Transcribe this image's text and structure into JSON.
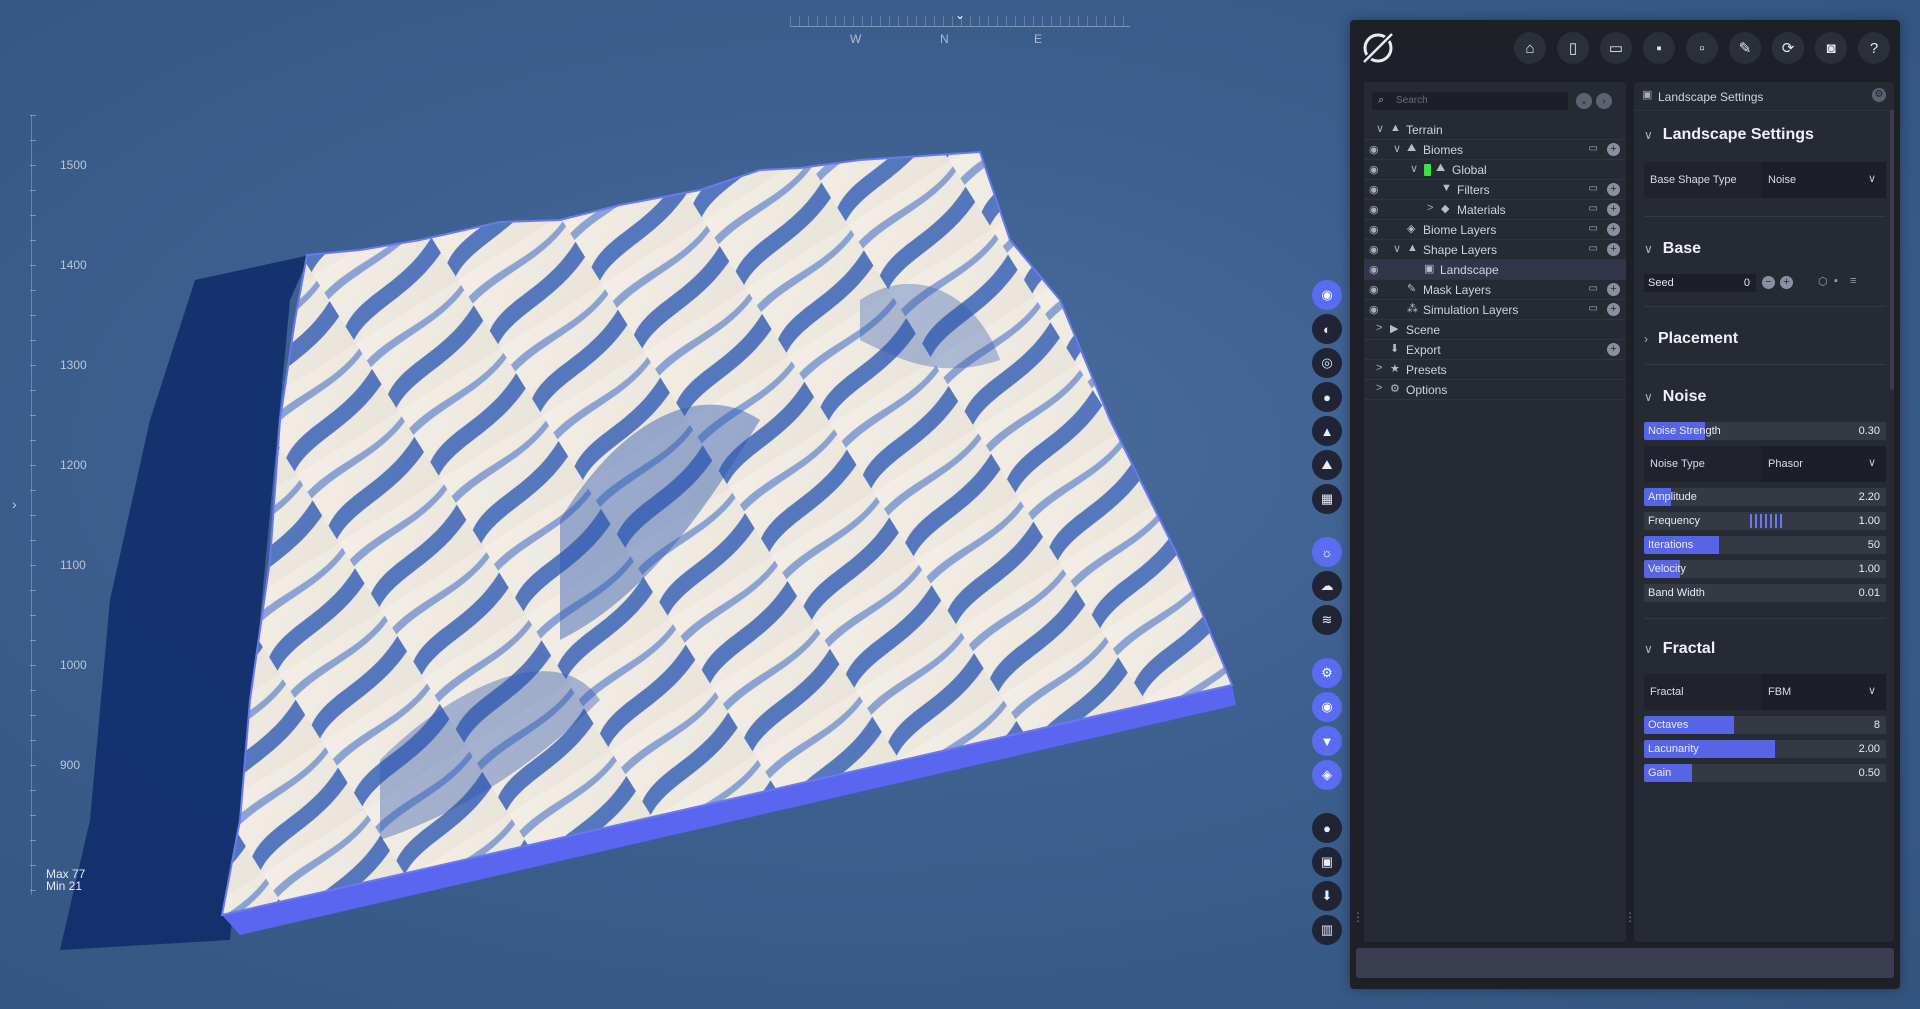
{
  "compass": {
    "labels": [
      "W",
      "N",
      "E"
    ]
  },
  "ruler": {
    "values": [
      "1500",
      "1400",
      "1300",
      "1200",
      "1100",
      "1000",
      "900"
    ],
    "max": "Max 77",
    "min": "Min 21"
  },
  "colors": {
    "accent": "#5b6cf0",
    "panel": "#1d2027",
    "inner": "#262a33",
    "green": "#3ee04a"
  },
  "tools": [
    {
      "name": "terrain-mode-icon",
      "glyph": "◉",
      "active": true
    },
    {
      "name": "globe-icon",
      "glyph": "◐",
      "active": false
    },
    {
      "name": "biome-icon",
      "glyph": "◎",
      "active": false
    },
    {
      "name": "water-drop-icon",
      "glyph": "●",
      "active": false
    },
    {
      "name": "mountain-icon",
      "glyph": "▲",
      "active": false
    },
    {
      "name": "erosion-icon",
      "glyph": "⛰",
      "active": false
    },
    {
      "name": "grid-icon",
      "glyph": "▦",
      "active": false
    },
    {
      "name": "sun-icon",
      "glyph": "☼",
      "active": true
    },
    {
      "name": "clouds-icon",
      "glyph": "☁",
      "active": false
    },
    {
      "name": "fog-icon",
      "glyph": "≋",
      "active": false
    },
    {
      "name": "settings-icon",
      "glyph": "⚙",
      "active": true
    },
    {
      "name": "eye-icon",
      "glyph": "◉",
      "active": true
    },
    {
      "name": "filter-icon",
      "glyph": "▼",
      "active": true
    },
    {
      "name": "layers-icon",
      "glyph": "◈",
      "active": true
    },
    {
      "name": "record-icon",
      "glyph": "●",
      "active": false
    },
    {
      "name": "image-icon",
      "glyph": "▣",
      "active": false
    },
    {
      "name": "download-icon",
      "glyph": "⬇",
      "active": false
    },
    {
      "name": "stats-icon",
      "glyph": "▥",
      "active": false
    }
  ],
  "toolbar": [
    {
      "name": "home-icon",
      "glyph": "⌂"
    },
    {
      "name": "new-file-icon",
      "glyph": "▯"
    },
    {
      "name": "open-folder-icon",
      "glyph": "▭"
    },
    {
      "name": "save-icon",
      "glyph": "▪"
    },
    {
      "name": "save-as-icon",
      "glyph": "▫"
    },
    {
      "name": "export-file-icon",
      "glyph": "✎"
    },
    {
      "name": "refresh-icon",
      "glyph": "⟳"
    },
    {
      "name": "camera-icon",
      "glyph": "◙"
    },
    {
      "name": "help-icon",
      "glyph": "?"
    }
  ],
  "tree": {
    "search_placeholder": "Search",
    "rows": [
      {
        "label": "Terrain",
        "indent": 0,
        "eye": false,
        "chev": "∨",
        "icon": "▲",
        "fold": false,
        "plus": false,
        "sel": false
      },
      {
        "label": "Biomes",
        "indent": 1,
        "eye": true,
        "chev": "∨",
        "icon": "⛰",
        "fold": true,
        "plus": true,
        "sel": false
      },
      {
        "label": "Global",
        "indent": 2,
        "eye": true,
        "chev": "∨",
        "icon": "⛰",
        "fold": false,
        "plus": false,
        "sel": false,
        "green": true
      },
      {
        "label": "Filters",
        "indent": 3,
        "eye": true,
        "chev": "",
        "icon": "▼",
        "fold": true,
        "plus": true,
        "sel": false
      },
      {
        "label": "Materials",
        "indent": 3,
        "eye": true,
        "chev": ">",
        "icon": "◆",
        "fold": true,
        "plus": true,
        "sel": false
      },
      {
        "label": "Biome Layers",
        "indent": 1,
        "eye": true,
        "chev": "",
        "icon": "◈",
        "fold": true,
        "plus": true,
        "sel": false
      },
      {
        "label": "Shape Layers",
        "indent": 1,
        "eye": true,
        "chev": "∨",
        "icon": "▲",
        "fold": true,
        "plus": true,
        "sel": false
      },
      {
        "label": "Landscape",
        "indent": 2,
        "eye": true,
        "chev": "",
        "icon": "▣",
        "fold": false,
        "plus": false,
        "sel": true
      },
      {
        "label": "Mask Layers",
        "indent": 1,
        "eye": true,
        "chev": "",
        "icon": "✎",
        "fold": true,
        "plus": true,
        "sel": false
      },
      {
        "label": "Simulation Layers",
        "indent": 1,
        "eye": true,
        "chev": "",
        "icon": "⁂",
        "fold": true,
        "plus": true,
        "sel": false
      },
      {
        "label": "Scene",
        "indent": 0,
        "eye": false,
        "chev": ">",
        "icon": "▶",
        "fold": false,
        "plus": false,
        "sel": false
      },
      {
        "label": "Export",
        "indent": 0,
        "eye": false,
        "chev": "",
        "icon": "⬇",
        "fold": false,
        "plus": true,
        "sel": false
      },
      {
        "label": "Presets",
        "indent": 0,
        "eye": false,
        "chev": ">",
        "icon": "★",
        "fold": false,
        "plus": false,
        "sel": false
      },
      {
        "label": "Options",
        "indent": 0,
        "eye": false,
        "chev": ">",
        "icon": "⚙",
        "fold": false,
        "plus": false,
        "sel": false
      }
    ]
  },
  "props": {
    "header": "Landscape Settings",
    "landscape_settings": {
      "title": "Landscape Settings",
      "base_shape_type_label": "Base Shape Type",
      "base_shape_type_value": "Noise"
    },
    "base": {
      "title": "Base",
      "seed_label": "Seed",
      "seed_value": "0"
    },
    "placement": {
      "title": "Placement"
    },
    "noise": {
      "title": "Noise",
      "noise_strength": {
        "label": "Noise Strength",
        "value": "0.30",
        "fill": 0.25
      },
      "noise_type_label": "Noise Type",
      "noise_type_value": "Phasor",
      "amplitude": {
        "label": "Amplitude",
        "value": "2.20",
        "fill": 0.11
      },
      "frequency": {
        "label": "Frequency",
        "value": "1.00",
        "fill": 0
      },
      "iterations": {
        "label": "Iterations",
        "value": "50",
        "fill": 0.31
      },
      "velocity": {
        "label": "Velocity",
        "value": "1.00",
        "fill": 0.15
      },
      "band_width": {
        "label": "Band Width",
        "value": "0.01",
        "fill": 0
      }
    },
    "fractal": {
      "title": "Fractal",
      "fractal_label": "Fractal",
      "fractal_value": "FBM",
      "octaves": {
        "label": "Octaves",
        "value": "8",
        "fill": 0.37
      },
      "lacunarity": {
        "label": "Lacunarity",
        "value": "2.00",
        "fill": 0.54
      },
      "gain": {
        "label": "Gain",
        "value": "0.50",
        "fill": 0.2
      }
    }
  }
}
